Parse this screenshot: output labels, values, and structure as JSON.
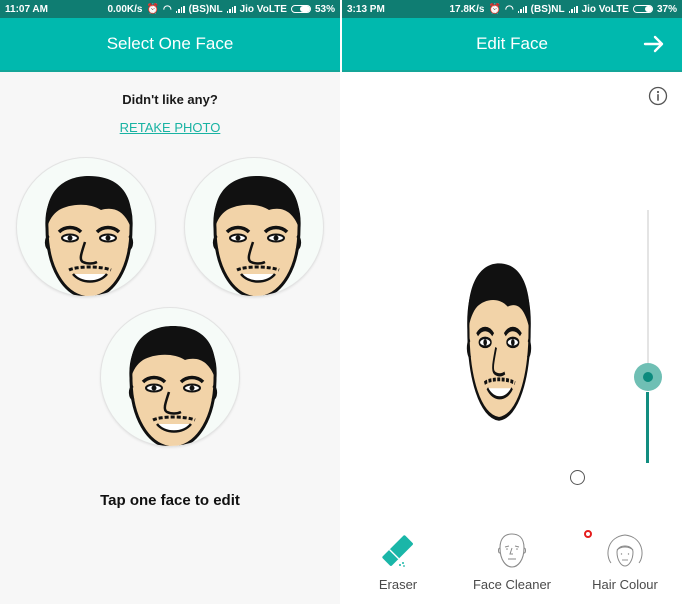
{
  "left_screen": {
    "status_bar": {
      "time": "11:07 AM",
      "speed": "0.00K/s",
      "carrier1": "(BS)NL",
      "carrier2": "Jio VoLTE",
      "battery": "53%",
      "battery_level": 0.53
    },
    "title": "Select One Face",
    "prompt": "Didn't like any?",
    "retake_label": "RETAKE PHOTO",
    "faces": [
      {
        "name": "face-option-1"
      },
      {
        "name": "face-option-2"
      },
      {
        "name": "face-option-3"
      }
    ],
    "footer_text": "Tap one face to edit"
  },
  "right_screen": {
    "status_bar": {
      "time": "3:13 PM",
      "speed": "17.8K/s",
      "carrier1": "(BS)NL",
      "carrier2": "Jio VoLTE",
      "battery": "37%",
      "battery_level": 0.37
    },
    "title": "Edit Face",
    "next_icon": "arrow-right-icon",
    "info_icon": "info-icon",
    "slider_value": 0.34,
    "tools": [
      {
        "label": "Eraser",
        "icon": "eraser-icon"
      },
      {
        "label": "Face Cleaner",
        "icon": "face-cleaner-icon"
      },
      {
        "label": "Hair Colour",
        "icon": "hair-colour-icon"
      }
    ]
  },
  "colors": {
    "accent": "#00b9ae",
    "status_bar": "#0f7d72",
    "link": "#19b3a3",
    "slider_active": "#118d80",
    "slider_thumb": "#6fbfb4"
  }
}
